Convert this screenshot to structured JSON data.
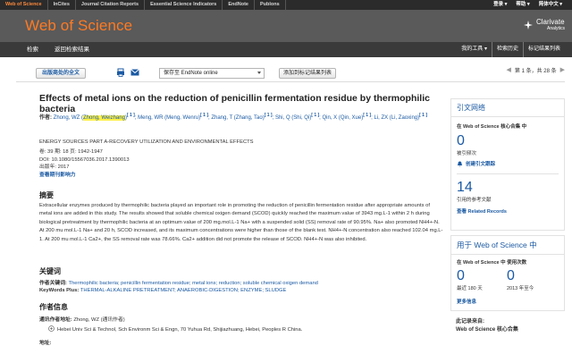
{
  "topbar": {
    "items": [
      "Web of Science",
      "InCites",
      "Journal Citation Reports",
      "Essential Science Indicators",
      "EndNote",
      "Publons"
    ],
    "right": [
      "登录 ▾",
      "帮助 ▾",
      "简体中文 ▾"
    ]
  },
  "brand": {
    "logo": "Web of Science",
    "company": "Clarivate",
    "company_sub": "Analytics"
  },
  "nav": {
    "left": [
      "检索",
      "返回检索结果"
    ],
    "right": [
      "我的工具 ▾",
      "检索历史",
      "标记结果列表"
    ]
  },
  "toolbar": {
    "fulltext_btn": "出版商处的全文",
    "save_select": "保存至 EndNote online",
    "add_marked_btn": "添加到标记结果列表",
    "pager": "第 1 条，共 28 条"
  },
  "article": {
    "title": "Effects of metal ions on the reduction of penicillin fermentation residue by thermophilic bacteria",
    "authors_label": "作者:",
    "authors": [
      {
        "pre": "Zhong, WZ (",
        "hl": "Zhong, Weizhang",
        "post": ")",
        "sup": "[ 1 ]"
      },
      {
        "pre": "Meng, WR (Meng, Wenru)",
        "hl": "",
        "post": "",
        "sup": "[ 1 ]"
      },
      {
        "pre": "Zhang, T (Zhang, Tao)",
        "hl": "",
        "post": "",
        "sup": "[ 1 ]"
      },
      {
        "pre": "Shi, Q (Shi, Qi)",
        "hl": "",
        "post": "",
        "sup": "[ 1 ]"
      },
      {
        "pre": "Qin, X (Qin, Xue)",
        "hl": "",
        "post": "",
        "sup": "[ 1 ]"
      },
      {
        "pre": "Li, ZX (Li, Zaoxing)",
        "hl": "",
        "post": "",
        "sup": "[ 1 ]"
      }
    ],
    "journal": "ENERGY SOURCES PART A-RECOVERY UTILIZATION AND ENVIRONMENTAL EFFECTS",
    "volume_line": "卷: 39   期: 18   页: 1942-1947",
    "doi_line": "DOI: 10.1080/15567036.2017.1390013",
    "pub_line": "出版年: 2017",
    "impact_link": "查看期刊影响力",
    "abstract_heading": "摘要",
    "abstract": "Extracellular enzymes produced by thermophilic bacteria played an important role in promoting the reduction of penicillin fermentation residue after appropriate amounts of metal ions are added in this study. The results showed that soluble chemical oxigen demand (SCOD) quickly reached the maximum value of 3943 mg.L-1 within 2 h during biological pretreatment by thermophilic bacteria at an optimum value of 200 mg.mol.L-1 Na+ with a suspended solid (SS) removal rate of 90.95%. Na+ also promoted NH4+-N. At 200 mu mol.L-1 Na+ and 20 h, SCOD increased, and its maximum concentrations were higher than those of the blank test. NH4+-N concentration also reached 102.04 mg.L-1. At 200 mu mol.L-1 Ca2+, the SS removal rate was 78.66%. Ca2+ addition did not promote the release of SCOD. NH4+-N was also inhibited.",
    "keywords_heading": "关键词",
    "kw_author_label": "作者关键词:",
    "kw_author": "Thermophilic bacteria; penicillin fermentation residue; metal ions; reduction; soluble chemical oxigen demand",
    "kw_plus_label": "KeyWords Plus:",
    "kw_plus": "THERMAL-ALKALINE PRETREATMENT; ANAEROBIC-DIGESTION; ENZYME; SLUDGE",
    "info_heading": "作者信息",
    "corr_label": "通讯作者地址:",
    "corr_value": "Zhong, WZ (通讯作者)",
    "addr_label": "",
    "addr_value": "Hebei Univ Sci & Technol, Sch Environm Sci & Engn, 70 Yuhua Rd, Shijiazhuang, Hebei, Peoples R China.",
    "addr_next": "地址:"
  },
  "sidebar": {
    "citation_title": "引文网络",
    "in_core": "在 Web of Science 核心合集 中",
    "cited_count": "0",
    "cited_label": "被引频次",
    "create_alert": "创建引文跟踪",
    "refs_count": "14",
    "refs_label": "引用的参考文献",
    "related": "查看 Related Records",
    "usage_title": "用于 Web of Science 中",
    "usage_sub": "在 Web of Science 中 使用次数",
    "usage_180": "0",
    "usage_180_label": "最近 180 天",
    "usage_2013": "0",
    "usage_2013_label": "2013 年至今",
    "more_link": "更多信息",
    "record_from": "此记录来自:",
    "record_src": "Web of Science 核心合集"
  }
}
